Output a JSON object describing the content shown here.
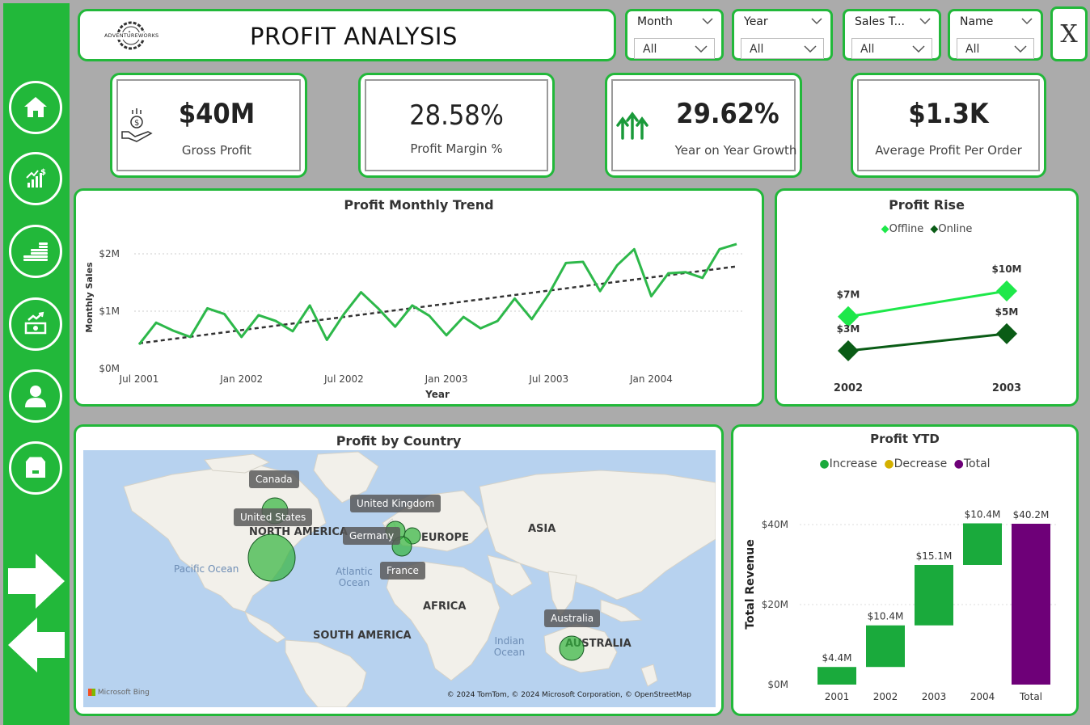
{
  "header": {
    "logo_text": "ADVENTUREWORKS",
    "title": "PROFIT ANALYSIS"
  },
  "slicers": [
    {
      "label": "Month",
      "value": "All"
    },
    {
      "label": "Year",
      "value": "All"
    },
    {
      "label": "Sales T...",
      "value": "All"
    },
    {
      "label": "Name",
      "value": "All"
    }
  ],
  "close_label": "X",
  "kpis": [
    {
      "value": "$40M",
      "label": "Gross Profit",
      "icon": "money-hand-icon"
    },
    {
      "value": "28.58%",
      "label": "Profit Margin %",
      "icon": ""
    },
    {
      "value": "29.62%",
      "label": "Year on Year Growth",
      "icon": "growth-arrows-icon"
    },
    {
      "value": "$1.3K",
      "label": "Average Profit Per Order",
      "icon": ""
    }
  ],
  "nav_icons": [
    "home-icon",
    "sales-chart-icon",
    "coins-icon",
    "cash-trend-icon",
    "user-icon",
    "product-box-icon",
    "next-arrow-icon",
    "back-arrow-icon"
  ],
  "colors": {
    "brand_green": "#22b83a",
    "line_green": "#2db84a",
    "offline": "#1ee84a",
    "online": "#0a5c16",
    "increase": "#1aaa3c",
    "decrease": "#d4b000",
    "total": "#6e0078"
  },
  "map": {
    "title": "Profit by Country",
    "countries": [
      "Canada",
      "United States",
      "United Kingdom",
      "Germany",
      "France",
      "Australia"
    ],
    "continents": [
      "NORTH AMERICA",
      "EUROPE",
      "ASIA",
      "AFRICA",
      "SOUTH AMERICA",
      "AUSTRALIA"
    ],
    "oceans": [
      "Pacific Ocean",
      "Atlantic Ocean",
      "Indian Ocean"
    ],
    "bing_label": "Microsoft Bing",
    "attribution": "© 2024 TomTom, © 2024 Microsoft Corporation, © OpenStreetMap"
  },
  "chart_data": [
    {
      "type": "line",
      "title": "Profit Monthly Trend",
      "xlabel": "Year",
      "ylabel": "Monthly Sales",
      "x_ticks": [
        "Jul 2001",
        "Jan 2002",
        "Jul 2002",
        "Jan 2003",
        "Jul 2003",
        "Jan 2004"
      ],
      "y_ticks": [
        "$0M",
        "$1M",
        "$2M"
      ],
      "ylim": [
        0,
        2.0
      ],
      "x_start": "Jul 2001",
      "values": [
        0.42,
        0.8,
        0.66,
        0.55,
        1.05,
        0.95,
        0.55,
        0.93,
        0.83,
        0.65,
        1.1,
        0.5,
        0.95,
        1.33,
        1.05,
        0.73,
        1.1,
        0.92,
        0.58,
        0.9,
        0.7,
        0.83,
        1.22,
        0.86,
        1.3,
        1.84,
        1.86,
        1.35,
        1.8,
        2.08,
        1.26,
        1.66,
        1.68,
        1.58,
        2.08,
        2.17
      ],
      "trendline": [
        0.44,
        1.78
      ],
      "grid": true
    },
    {
      "type": "line",
      "title": "Profit Rise",
      "categories": [
        "2002",
        "2003"
      ],
      "series": [
        {
          "name": "Offline",
          "values": [
            7,
            10
          ],
          "labels": [
            "$7M",
            "$10M"
          ]
        },
        {
          "name": "Online",
          "values": [
            3,
            5
          ],
          "labels": [
            "$3M",
            "$5M"
          ]
        }
      ],
      "legend": "top-center"
    },
    {
      "type": "bar",
      "subtype": "waterfall",
      "title": "Profit YTD",
      "ylabel": "Total Revenue",
      "categories": [
        "2001",
        "2002",
        "2003",
        "2004",
        "Total"
      ],
      "values": [
        4.4,
        10.4,
        15.1,
        10.4,
        40.2
      ],
      "labels": [
        "$4.4M",
        "$10.4M",
        "$15.1M",
        "$10.4M",
        "$40.2M"
      ],
      "kinds": [
        "increase",
        "increase",
        "increase",
        "increase",
        "total"
      ],
      "legend_items": [
        "Increase",
        "Decrease",
        "Total"
      ],
      "y_ticks": [
        "$0M",
        "$20M",
        "$40M"
      ],
      "ylim": [
        0,
        40.2
      ],
      "legend": "top-center"
    }
  ]
}
